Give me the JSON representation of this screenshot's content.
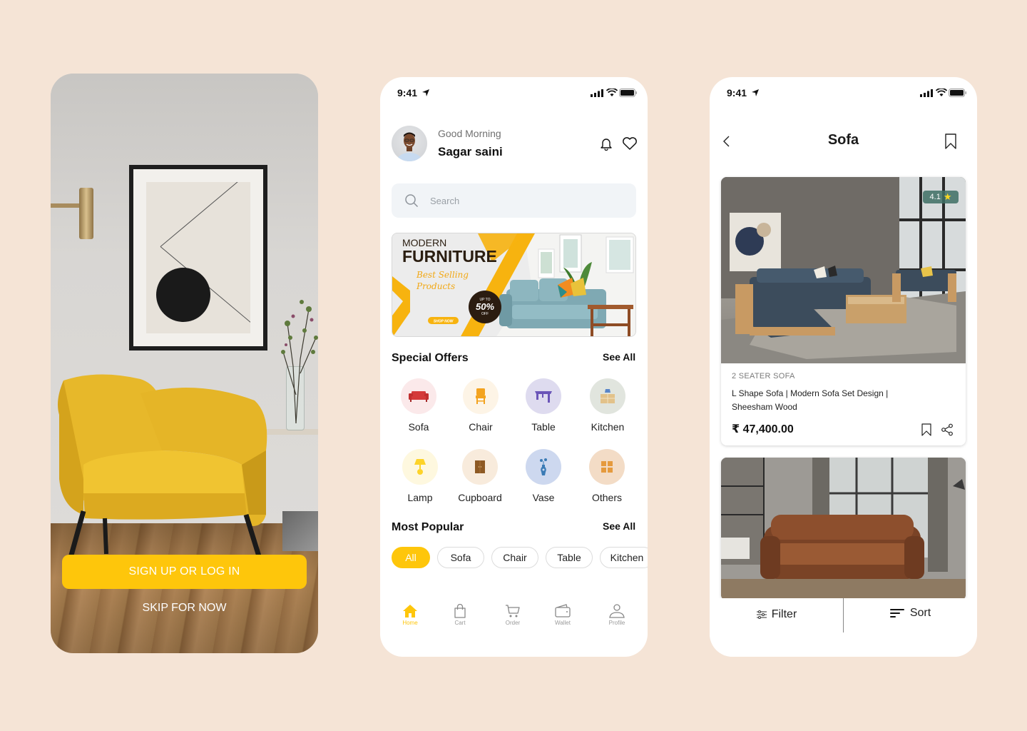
{
  "onboarding": {
    "signup_label": "SIGN UP OR LOG IN",
    "skip_label": "SKIP FOR NOW"
  },
  "home": {
    "status": {
      "time": "9:41"
    },
    "greeting": "Good Morning",
    "user_name": "Sagar saini",
    "search": {
      "placeholder": "Search",
      "value": ""
    },
    "banner": {
      "line1": "MODERN",
      "line2": "FURNITURE",
      "tagline1": "Best Selling",
      "tagline2": "Products",
      "badge_top": "UP TO",
      "badge_value": "50%",
      "badge_bottom": "OFF",
      "cta": "SHOP NOW"
    },
    "special_offers": {
      "title": "Special Offers",
      "see_all": "See All",
      "categories": [
        {
          "label": "Sofa",
          "icon": "sofa-icon",
          "bg": "#fbe9ea",
          "color": "#d43a3a"
        },
        {
          "label": "Chair",
          "icon": "chair-icon",
          "bg": "#fdf4e6",
          "color": "#f3a31f"
        },
        {
          "label": "Table",
          "icon": "table-icon",
          "bg": "#dedbef",
          "color": "#6a55b8"
        },
        {
          "label": "Kitchen",
          "icon": "kitchen-icon",
          "bg": "#e1e5de",
          "color": "#e2c28a"
        },
        {
          "label": "Lamp",
          "icon": "lamp-icon",
          "bg": "#fef8df",
          "color": "#fdd329"
        },
        {
          "label": "Cupboard",
          "icon": "cupboard-icon",
          "bg": "#f8ebdc",
          "color": "#8e5a24"
        },
        {
          "label": "Vase",
          "icon": "vase-icon",
          "bg": "#cdd8ef",
          "color": "#3b7bb5"
        },
        {
          "label": "Others",
          "icon": "others-icon",
          "bg": "#f3dcc6",
          "color": "#e59a3e"
        }
      ]
    },
    "most_popular": {
      "title": "Most Popular",
      "see_all": "See All",
      "chips": [
        "All",
        "Sofa",
        "Chair",
        "Table",
        "Kitchen"
      ],
      "active_chip": "All"
    },
    "nav": [
      {
        "label": "Home",
        "icon": "home-icon",
        "active": true
      },
      {
        "label": "Cart",
        "icon": "cart-bag-icon",
        "active": false
      },
      {
        "label": "Order",
        "icon": "shopping-cart-icon",
        "active": false
      },
      {
        "label": "Wallet",
        "icon": "wallet-icon",
        "active": false
      },
      {
        "label": "Profile",
        "icon": "profile-icon",
        "active": false
      }
    ]
  },
  "sofa": {
    "status": {
      "time": "9:41"
    },
    "title": "Sofa",
    "products": [
      {
        "rating": "4.1",
        "subtitle": "2 SEATER SOFA",
        "description": "L Shape Sofa | Modern Sofa Set Design | Sheesham Wood",
        "price": "₹ 47,400.00"
      }
    ],
    "filter_label": "Filter",
    "sort_label": "Sort"
  },
  "colors": {
    "accent": "#fec60b",
    "background": "#f5e4d6"
  }
}
